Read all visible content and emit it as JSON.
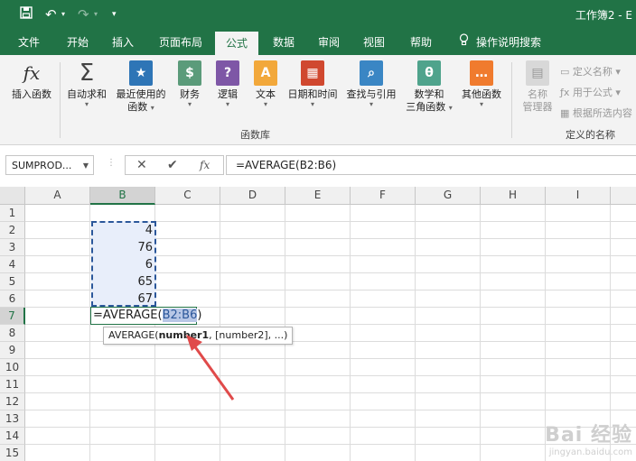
{
  "window": {
    "title": "工作簿2 - E"
  },
  "quick_access": {
    "save_icon": "save-icon",
    "undo_icon": "undo-icon",
    "redo_icon": "redo-icon",
    "customize_icon": "customize-icon"
  },
  "tabs": [
    "文件",
    "开始",
    "插入",
    "页面布局",
    "公式",
    "数据",
    "审阅",
    "视图",
    "帮助"
  ],
  "active_tab": "公式",
  "tell_me": "操作说明搜索",
  "ribbon": {
    "insert_function": "插入函数",
    "autosum": "自动求和",
    "recent_line1": "最近使用的",
    "recent_line2": "函数",
    "financial": "财务",
    "logical": "逻辑",
    "text": "文本",
    "datetime": "日期和时间",
    "lookup": "查找与引用",
    "math_line1": "数学和",
    "math_line2": "三角函数",
    "more": "其他函数",
    "name_mgr_line1": "名称",
    "name_mgr_line2": "管理器",
    "define_name": "定义名称",
    "use_in_formula": "用于公式",
    "create_from_sel": "根据所选内容",
    "group_library": "函数库",
    "group_names": "定义的名称"
  },
  "formula_bar": {
    "name_box": "SUMPROD...",
    "cancel": "✕",
    "enter": "✔",
    "fx": "fx",
    "formula": "=AVERAGE(B2:B6)"
  },
  "columns": [
    "A",
    "B",
    "C",
    "D",
    "E",
    "F",
    "G",
    "H",
    "I"
  ],
  "rows": [
    "1",
    "2",
    "3",
    "4",
    "5",
    "6",
    "7",
    "8",
    "9",
    "10",
    "11",
    "12",
    "13",
    "14",
    "15"
  ],
  "cells": {
    "B2": "4",
    "B3": "76",
    "B4": "6",
    "B5": "65",
    "B6": "67"
  },
  "edit_cell": {
    "prefix": "=AVERAGE(",
    "ref": "B2:B6",
    "suffix": ")"
  },
  "tooltip": {
    "fn": "AVERAGE(",
    "arg1": "number1",
    "rest": ", [number2], ...)"
  },
  "watermark": {
    "main": "Bai 经验",
    "sub": "jingyan.baidu.com"
  },
  "colors": {
    "accent": "#217346",
    "range_border": "#2b579a",
    "arrow": "#e04a4a"
  }
}
